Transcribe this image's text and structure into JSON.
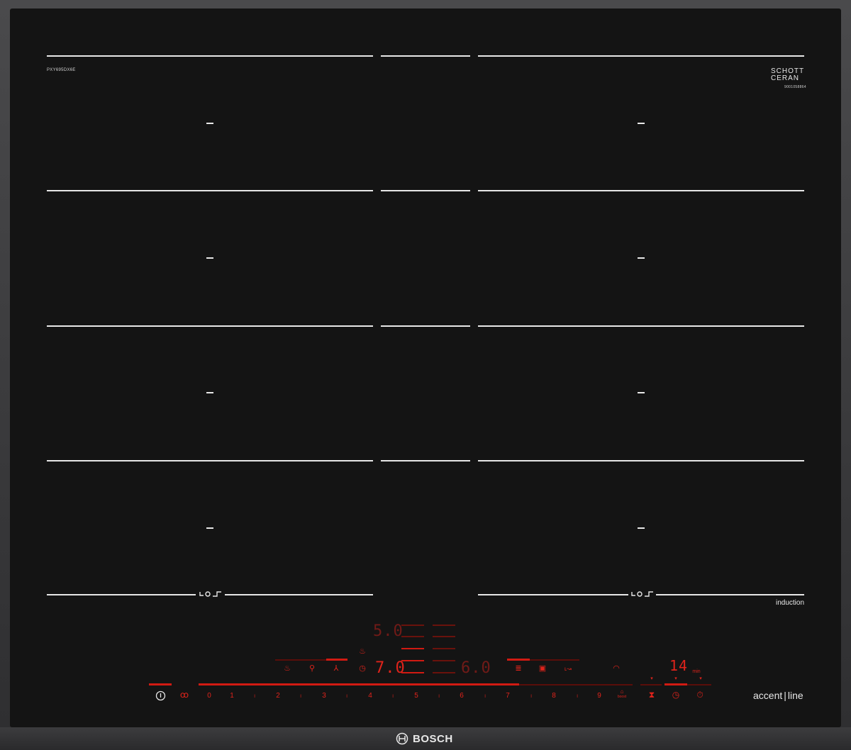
{
  "model_label": "PXY695DX6E",
  "glass_brand": {
    "line1": "SCHOTT",
    "line2": "CERAN",
    "serial": "9001058864"
  },
  "induction_label": "induction",
  "series_label": {
    "part1": "accent",
    "part2": "line"
  },
  "brand_name": "BOSCH",
  "zone_icons": {
    "left": "flex-zone-icon",
    "right": "flex-zone-icon"
  },
  "display": {
    "upper_left_value": "5.0",
    "main_left_value": "7.0",
    "main_right_value": "6.0",
    "timer_value": "14",
    "timer_unit": "min"
  },
  "power_scale": [
    "0",
    "1",
    "2",
    "3",
    "4",
    "5",
    "6",
    "7",
    "8",
    "9"
  ],
  "boost_label": "boost",
  "colors": {
    "glass": "#141414",
    "display_red": "#e0231b",
    "frame": "#3a3a3c",
    "lines": "#e8e8e8"
  }
}
